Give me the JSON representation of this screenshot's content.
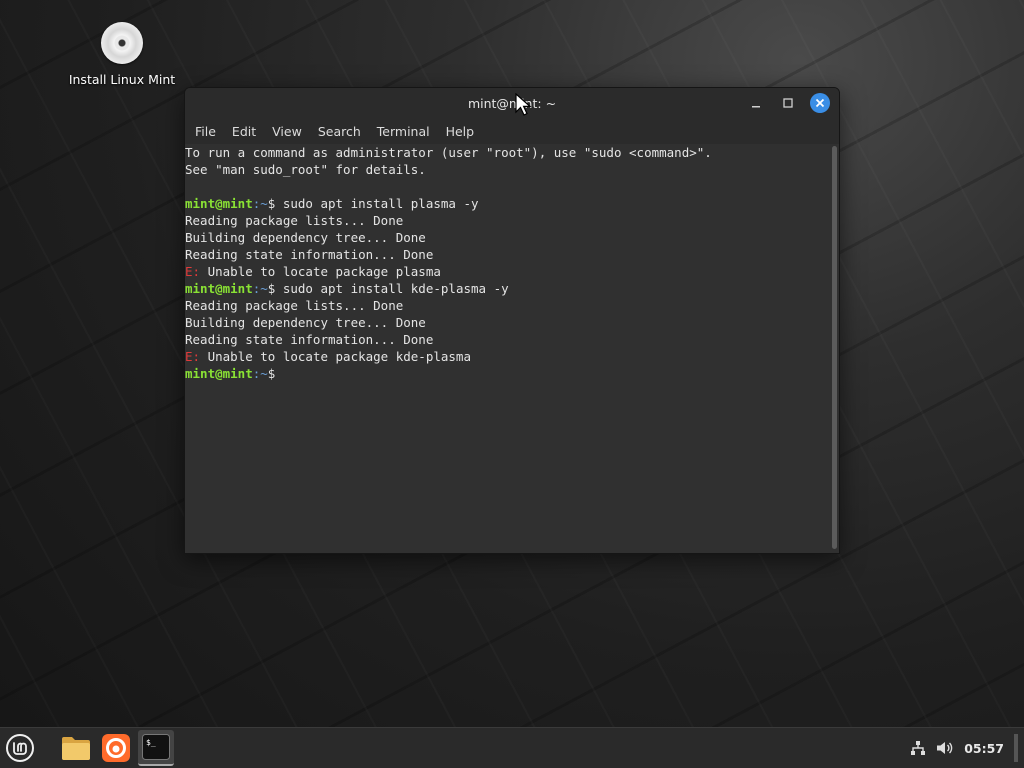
{
  "desktop": {
    "icons": [
      {
        "label": "Install Linux Mint",
        "icon": "disc-icon"
      }
    ]
  },
  "window": {
    "title": "mint@mint: ~",
    "menu": [
      "File",
      "Edit",
      "View",
      "Search",
      "Terminal",
      "Help"
    ],
    "controls": [
      "minimize-icon",
      "maximize-icon",
      "close-icon"
    ],
    "accent_close": "#3a8ee6"
  },
  "terminal": {
    "lines": [
      {
        "kind": "text",
        "text": "To run a command as administrator (user \"root\"), use \"sudo <command>\"."
      },
      {
        "kind": "text",
        "text": "See \"man sudo_root\" for details."
      },
      {
        "kind": "text",
        "text": ""
      },
      {
        "kind": "prompt",
        "user": "mint@mint",
        "path": ":~",
        "sym": "$ ",
        "cmd": "sudo apt install plasma -y"
      },
      {
        "kind": "text",
        "text": "Reading package lists... Done"
      },
      {
        "kind": "text",
        "text": "Building dependency tree... Done"
      },
      {
        "kind": "text",
        "text": "Reading state information... Done"
      },
      {
        "kind": "error",
        "prefix": "E:",
        "text": " Unable to locate package plasma"
      },
      {
        "kind": "prompt",
        "user": "mint@mint",
        "path": ":~",
        "sym": "$ ",
        "cmd": "sudo apt install kde-plasma -y"
      },
      {
        "kind": "text",
        "text": "Reading package lists... Done"
      },
      {
        "kind": "text",
        "text": "Building dependency tree... Done"
      },
      {
        "kind": "text",
        "text": "Reading state information... Done"
      },
      {
        "kind": "error",
        "prefix": "E:",
        "text": " Unable to locate package kde-plasma"
      },
      {
        "kind": "prompt",
        "user": "mint@mint",
        "path": ":~",
        "sym": "$",
        "cmd": ""
      }
    ],
    "colors": {
      "user": "#8ae234",
      "error": "#e03a3a",
      "text": "#e4e4e4"
    }
  },
  "taskbar": {
    "menu_icon": "mint-logo-icon",
    "apps": [
      {
        "name": "files",
        "icon": "folder-icon",
        "active": false
      },
      {
        "name": "firefox",
        "icon": "firefox-icon",
        "active": false
      },
      {
        "name": "terminal",
        "icon": "terminal-icon",
        "active": true
      }
    ],
    "tray": {
      "network_icon": "network-icon",
      "volume_icon": "volume-icon",
      "clock": "05:57"
    }
  }
}
